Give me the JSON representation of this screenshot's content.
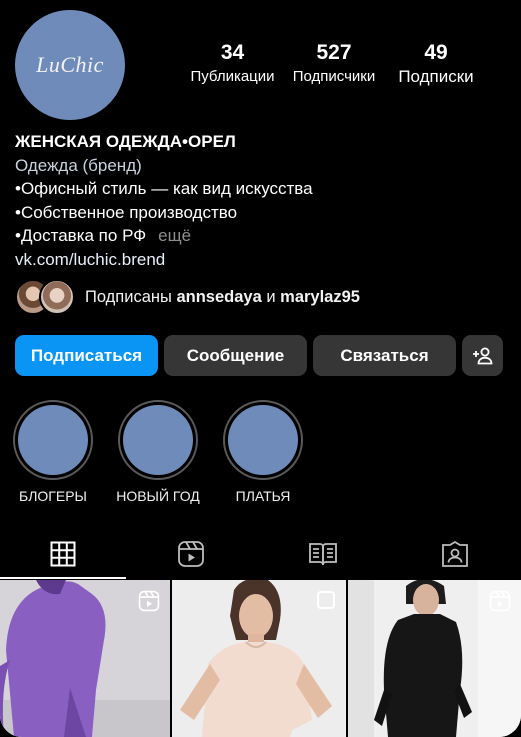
{
  "profile": {
    "avatar_text": "LuChic",
    "stats": {
      "posts_value": "34",
      "posts_label": "Публикации",
      "followers_value": "527",
      "followers_label": "Подписчики",
      "following_value": "49",
      "following_label": "Подписки"
    },
    "bio": {
      "name": "ЖЕНСКАЯ ОДЕЖДА•ОРЕЛ",
      "category": "Одежда (бренд)",
      "line1": "•Офисный стиль — как вид искусства",
      "line2": "•Собственное производство",
      "line3": "•Доставка по РФ",
      "more": "ещё",
      "link": "vk.com/luchic.brend"
    },
    "followed_by": {
      "prefix": "Подписаны",
      "user1": "annsedaya",
      "conjunction": "и",
      "user2": "marylaz95"
    }
  },
  "actions": {
    "follow_label": "Подписаться",
    "message_label": "Сообщение",
    "contact_label": "Связаться",
    "suggest_icon": "add-person-icon"
  },
  "highlights": [
    {
      "label": "БЛОГЕРЫ"
    },
    {
      "label": "НОВЫЙ ГОД"
    },
    {
      "label": "ПЛАТЬЯ"
    }
  ],
  "tabs": [
    {
      "icon": "grid-icon",
      "active": true
    },
    {
      "icon": "reels-icon",
      "active": false
    },
    {
      "icon": "guide-icon",
      "active": false
    },
    {
      "icon": "tagged-icon",
      "active": false
    }
  ],
  "posts": [
    {
      "type": "reel",
      "icon": "reels-icon"
    },
    {
      "type": "carousel",
      "icon": "carousel-icon"
    },
    {
      "type": "reel",
      "icon": "reels-icon"
    }
  ],
  "colors": {
    "background": "#000000",
    "accent_button": "#0a95f5",
    "secondary_button": "#363636",
    "avatar_fill": "#6f8bb9"
  }
}
